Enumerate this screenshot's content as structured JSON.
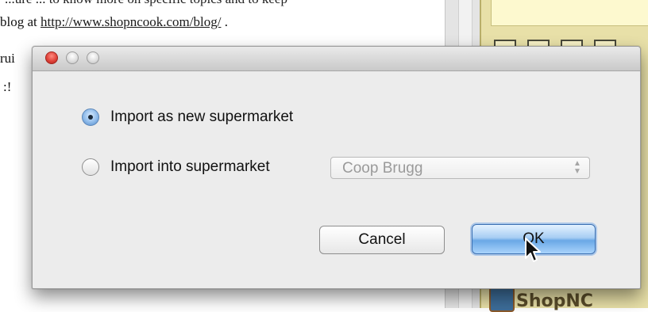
{
  "background": {
    "top_fragment": "...ure ... to know more on specific topics and to keep",
    "blog_prefix": "blog at",
    "blog_link": "http://www.shopncook.com/blog/",
    "blog_suffix": ".",
    "fragment_rui": "rui",
    "fragment_excl": ":!",
    "right_panel_brand": "ShopNC"
  },
  "dialog": {
    "title_buttons": [
      "close-icon",
      "minimize-icon",
      "zoom-icon"
    ],
    "options": [
      {
        "label": "Import as new supermarket",
        "selected": true
      },
      {
        "label": "Import into supermarket",
        "selected": false
      }
    ],
    "supermarket_select": {
      "value": "Coop Brugg",
      "enabled": false
    },
    "cancel_label": "Cancel",
    "ok_label": "OK"
  },
  "colors": {
    "accent": "#6aa8e6",
    "close_button": "#e0443b",
    "background_panel": "#e8e0a8"
  }
}
